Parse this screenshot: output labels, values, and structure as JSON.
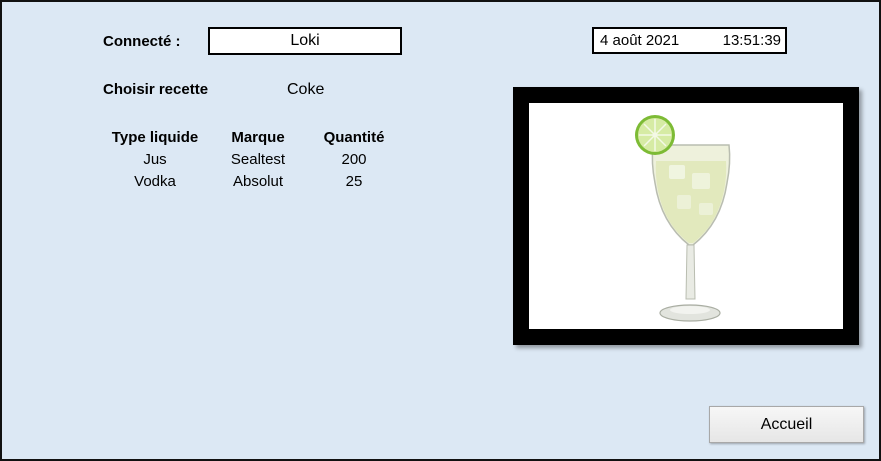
{
  "connected": {
    "label": "Connecté :",
    "user": "Loki"
  },
  "datetime": {
    "date": "4 août 2021",
    "time": "13:51:39"
  },
  "recipe": {
    "label": "Choisir recette",
    "value": "Coke"
  },
  "table": {
    "headers": {
      "type": "Type liquide",
      "brand": "Marque",
      "quantity": "Quantité"
    },
    "rows": [
      {
        "type": "Jus",
        "brand": "Sealtest",
        "quantity": "200"
      },
      {
        "type": "Vodka",
        "brand": "Absolut",
        "quantity": "25"
      }
    ]
  },
  "image": {
    "icon": "cocktail-glass-with-lime",
    "colors": {
      "frame": "#000000",
      "drink": "#e6ecc8",
      "lime": "#8cc63f"
    }
  },
  "buttons": {
    "home_label": "Accueil"
  },
  "colors": {
    "background": "#dce8f4",
    "border": "#111111"
  }
}
